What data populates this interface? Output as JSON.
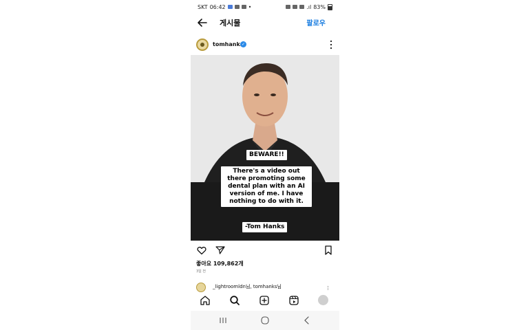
{
  "status_bar": {
    "carrier": "SKT",
    "time": "06:42",
    "battery": "83%"
  },
  "header": {
    "title": "게시물",
    "follow_label": "팔로우"
  },
  "post": {
    "username": "tomhanks",
    "image_text": {
      "warning": "BEWARE!!",
      "message": "There's a video out there promoting some dental plan with an AI version of me.  I have nothing to do with it.",
      "signature": "-Tom Hanks"
    },
    "likes": "좋아요 109,862개",
    "time_ago": "3일 전"
  },
  "comment_preview": {
    "text": "_lightroomldn님, tomhanks님"
  },
  "icons": {
    "back": "arrow-left-icon",
    "verified": "verified-badge-icon",
    "more": "more-vertical-icon",
    "like": "heart-icon",
    "share": "send-icon",
    "save": "bookmark-icon",
    "home": "home-icon",
    "search": "search-icon",
    "create": "plus-square-icon",
    "reels": "reels-icon",
    "profile": "profile-avatar-icon"
  },
  "colors": {
    "accent": "#1a7de0",
    "verified": "#2b8ae8"
  }
}
